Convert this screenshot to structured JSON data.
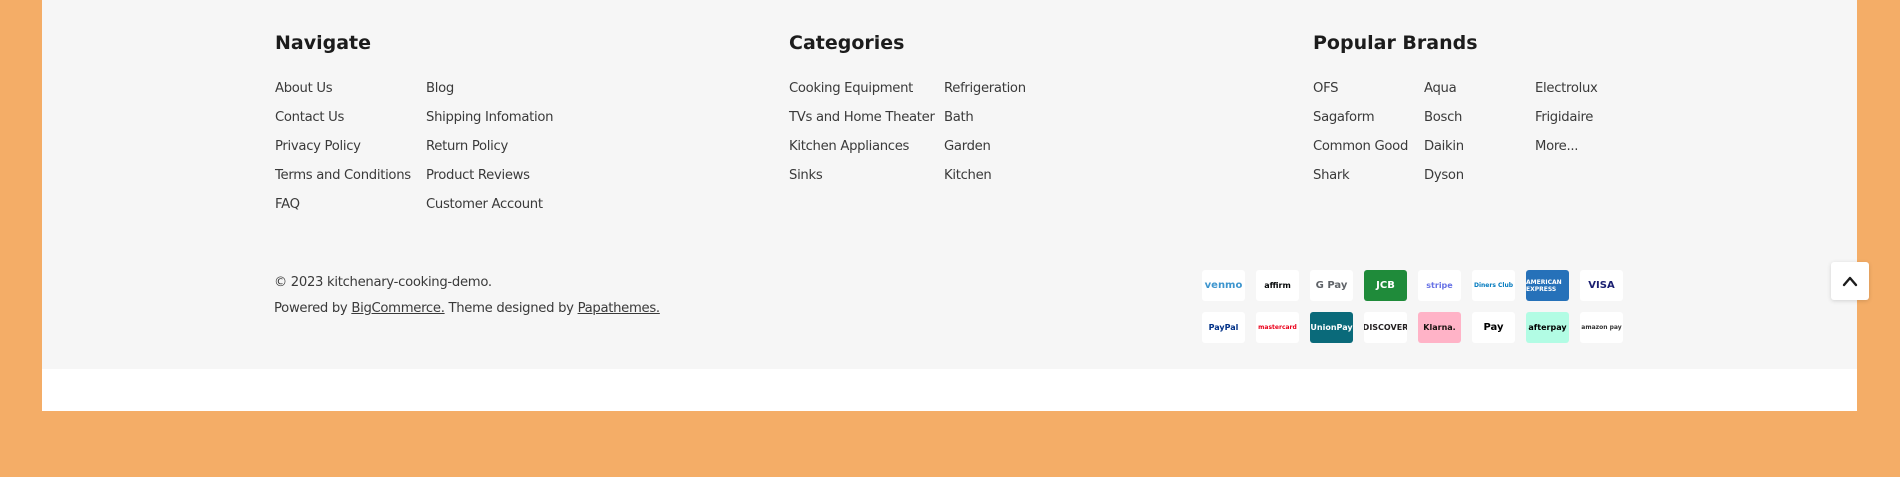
{
  "footer": {
    "navigate": {
      "title": "Navigate",
      "col1": [
        "About Us",
        "Contact Us",
        "Privacy Policy",
        "Terms and Conditions",
        "FAQ"
      ],
      "col2": [
        "Blog",
        "Shipping Infomation",
        "Return Policy",
        "Product Reviews",
        "Customer Account"
      ]
    },
    "categories": {
      "title": "Categories",
      "col1": [
        "Cooking Equipment",
        "TVs and Home Theater",
        "Kitchen Appliances",
        "Sinks"
      ],
      "col2": [
        "Refrigeration",
        "Bath",
        "Garden",
        "Kitchen"
      ]
    },
    "brands": {
      "title": "Popular Brands",
      "col1": [
        "OFS",
        "Sagaform",
        "Common Good",
        "Shark"
      ],
      "col2": [
        "Aqua",
        "Bosch",
        "Daikin",
        "Dyson"
      ],
      "col3": [
        "Electrolux",
        "Frigidaire",
        "More..."
      ]
    },
    "copyright": "© 2023 kitchenary-cooking-demo.",
    "powered_prefix": "Powered by ",
    "powered_link": "BigCommerce.",
    "theme_prefix": " Theme designed by ",
    "theme_link": "Papathemes.",
    "payments": {
      "row1": [
        {
          "label": "venmo",
          "icon": "venmo-icon",
          "color": "#3d95ce",
          "bg": "#ffffff"
        },
        {
          "label": "affirm",
          "icon": "affirm-icon",
          "color": "#060809",
          "bg": "#ffffff"
        },
        {
          "label": "G Pay",
          "icon": "google-pay-icon",
          "color": "#5f6368",
          "bg": "#ffffff"
        },
        {
          "label": "JCB",
          "icon": "jcb-icon",
          "color": "#ffffff",
          "bg": "#1f8b3a"
        },
        {
          "label": "stripe",
          "icon": "stripe-icon",
          "color": "#6772e5",
          "bg": "#ffffff"
        },
        {
          "label": "Diners Club",
          "icon": "diners-club-icon",
          "color": "#0079be",
          "bg": "#ffffff"
        },
        {
          "label": "AMERICAN EXPRESS",
          "icon": "amex-icon",
          "color": "#ffffff",
          "bg": "#2671b9"
        },
        {
          "label": "VISA",
          "icon": "visa-icon",
          "color": "#1a1f71",
          "bg": "#ffffff"
        }
      ],
      "row2": [
        {
          "label": "PayPal",
          "icon": "paypal-icon",
          "color": "#003087",
          "bg": "#ffffff"
        },
        {
          "label": "mastercard",
          "icon": "mastercard-icon",
          "color": "#eb001b",
          "bg": "#ffffff"
        },
        {
          "label": "UnionPay",
          "icon": "unionpay-icon",
          "color": "#ffffff",
          "bg": "#0a6a7a"
        },
        {
          "label": "DISCOVER",
          "icon": "discover-icon",
          "color": "#231f20",
          "bg": "#ffffff"
        },
        {
          "label": "Klarna.",
          "icon": "klarna-icon",
          "color": "#17120f",
          "bg": "#ffb3c7"
        },
        {
          "label": "Pay",
          "icon": "apple-pay-icon",
          "color": "#000000",
          "bg": "#ffffff"
        },
        {
          "label": "afterpay",
          "icon": "afterpay-icon",
          "color": "#000000",
          "bg": "#b2fce4"
        },
        {
          "label": "amazon pay",
          "icon": "amazon-pay-icon",
          "color": "#333333",
          "bg": "#ffffff"
        }
      ]
    }
  },
  "colors": {
    "page_bg": "#f4ad67",
    "footer_bg": "#f6f6f6"
  }
}
